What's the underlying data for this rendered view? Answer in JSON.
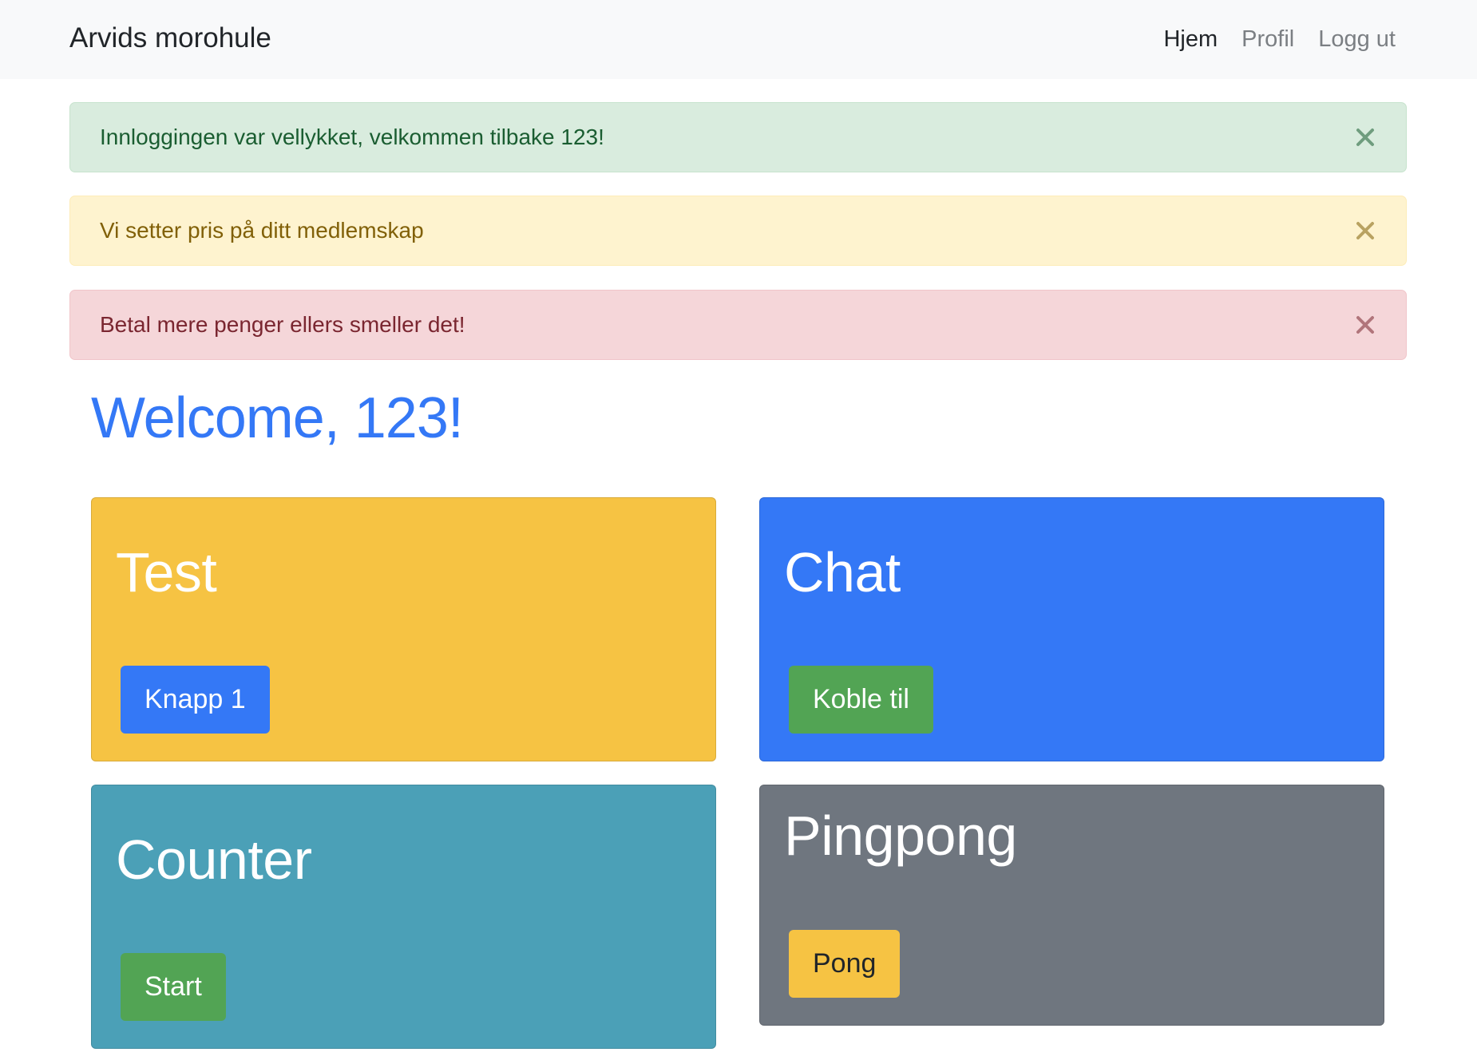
{
  "navbar": {
    "brand": "Arvids morohule",
    "links": [
      {
        "label": "Hjem",
        "active": true
      },
      {
        "label": "Profil",
        "active": false
      },
      {
        "label": "Logg ut",
        "active": false
      }
    ]
  },
  "alerts": [
    {
      "type": "success",
      "text": "Innloggingen var vellykket, velkommen tilbake 123!",
      "icon": "close-icon"
    },
    {
      "type": "warning",
      "text": "Vi setter pris på ditt medlemskap",
      "icon": "close-icon"
    },
    {
      "type": "danger",
      "text": "Betal mere penger ellers smeller det!",
      "icon": "close-icon"
    }
  ],
  "welcome": "Welcome, 123!",
  "cards": [
    {
      "title": "Test",
      "button": "Knapp 1",
      "color": "#f6c343",
      "button_color": "#3478f6"
    },
    {
      "title": "Chat",
      "button": "Koble til",
      "color": "#3478f6",
      "button_color": "#52a454"
    },
    {
      "title": "Counter",
      "button": "Start",
      "color": "#4ba0b7",
      "button_color": "#52a454"
    },
    {
      "title": "Pingpong",
      "button": "Pong",
      "color": "#6f767f",
      "button_color": "#f6c343"
    }
  ]
}
